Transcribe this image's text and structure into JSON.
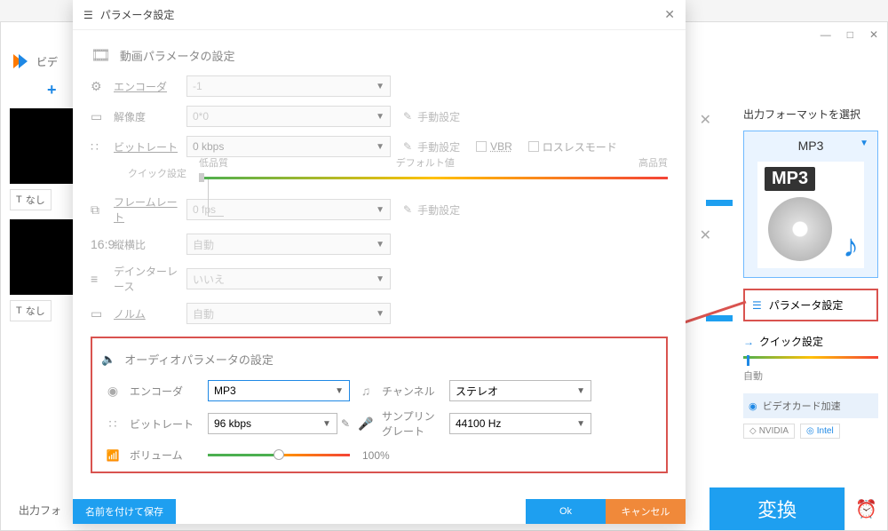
{
  "app": {
    "title": "ビデ"
  },
  "bg": {
    "plus": "+",
    "none_label": "なし",
    "output_label": "出力フォ"
  },
  "right": {
    "header": "出力フォーマットを選択",
    "format": "MP3",
    "param_btn": "パラメータ設定",
    "quick": "クイック設定",
    "auto": "自動",
    "gpu": "ビデオカード加速",
    "nvidia": "NVIDIA",
    "intel": "Intel",
    "convert": "変換"
  },
  "dialog": {
    "title": "パラメータ設定",
    "video_header": "動画パラメータの設定",
    "encoder": "エンコーダ",
    "encoder_val": "-1",
    "resolution": "解像度",
    "resolution_val": "0*0",
    "manual": "手動設定",
    "bitrate": "ビットレート",
    "bitrate_val": "0 kbps",
    "vbr": "VBR",
    "lossless": "ロスレスモード",
    "quick": "クイック設定",
    "low": "低品質",
    "default": "デフォルト値",
    "high": "高品質",
    "framerate": "フレームレート",
    "framerate_val": "0 fps",
    "aspect": "縦横比",
    "auto": "自動",
    "deinterlace": "デインターレース",
    "no": "いいえ",
    "norm": "ノルム",
    "audio_header": "オーディオパラメータの設定",
    "a_encoder": "エンコーダ",
    "a_encoder_val": "MP3",
    "a_bitrate": "ビットレート",
    "a_bitrate_val": "96 kbps",
    "channel": "チャンネル",
    "channel_val": "ステレオ",
    "samplerate": "サンプリングレート",
    "samplerate_val": "44100 Hz",
    "volume": "ボリューム",
    "vol_pct": "100%",
    "save_as": "名前を付けて保存",
    "ok": "Ok",
    "cancel": "キャンセル"
  }
}
